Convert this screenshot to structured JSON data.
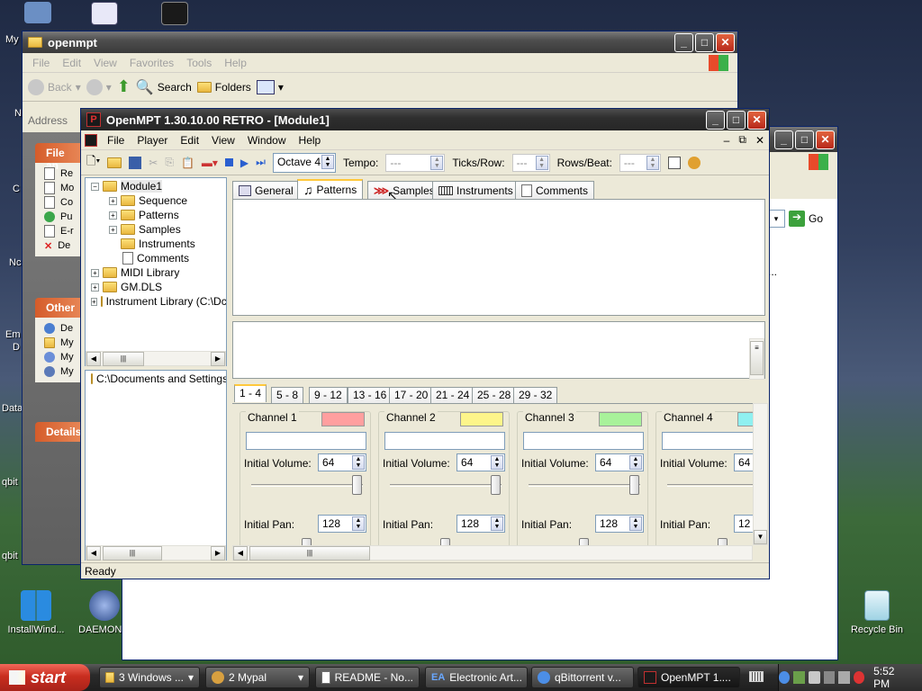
{
  "desktop": {
    "icons": [
      {
        "label": "InstallWind...",
        "color": "#1e88e5"
      },
      {
        "label": "DAEMON T",
        "color": "#3a5fa8"
      },
      {
        "label": "Recycle Bin",
        "color": "#d7eef7"
      }
    ],
    "partial_labels": [
      "My",
      "N",
      "C",
      "Nc",
      "Em",
      "D",
      "Data",
      "qbit",
      "qbit"
    ]
  },
  "explorer_window": {
    "title": "openmpt",
    "menu": [
      "File",
      "Edit",
      "View",
      "Favorites",
      "Tools",
      "Help"
    ],
    "toolbar": {
      "back": "Back",
      "search": "Search",
      "folders": "Folders"
    },
    "address_label": "Address",
    "go_label": "Go",
    "ellipsis": "...",
    "taskpane": {
      "file_head": "File an",
      "file_items": [
        "Re",
        "Mo",
        "Co",
        "Pu",
        "E-r",
        "De"
      ],
      "other_head": "Other",
      "other_items": [
        "De",
        "My",
        "My",
        "My"
      ],
      "details_head": "Details"
    }
  },
  "openmpt": {
    "title": "OpenMPT 1.30.10.00 RETRO - [Module1]",
    "menu": [
      "File",
      "Player",
      "Edit",
      "View",
      "Window",
      "Help"
    ],
    "toolbar": {
      "octave": "Octave 4",
      "tempo_label": "Tempo:",
      "tempo_value": "---",
      "ticks_label": "Ticks/Row:",
      "ticks_value": "---",
      "rows_label": "Rows/Beat:",
      "rows_value": "---"
    },
    "tree": {
      "root": "Module1",
      "children": [
        "Sequence",
        "Patterns",
        "Samples",
        "Instruments",
        "Comments"
      ],
      "others": [
        "MIDI Library",
        "GM.DLS",
        "Instrument Library (C:\\Dc"
      ]
    },
    "path": "C:\\Documents and Settings",
    "tabs": [
      "General",
      "Patterns",
      "Samples",
      "Instruments",
      "Comments"
    ],
    "selected_tab": "Patterns",
    "channel_tabs": [
      "1 - 4",
      "5 - 8",
      "9 - 12",
      "13 - 16",
      "17 - 20",
      "21 - 24",
      "25 - 28",
      "29 - 32"
    ],
    "channels": [
      {
        "name": "Channel 1",
        "color": "#ff9f9f",
        "volume_label": "Initial Volume:",
        "volume": "64",
        "pan_label": "Initial Pan:",
        "pan": "128"
      },
      {
        "name": "Channel 2",
        "color": "#fdf58a",
        "volume_label": "Initial Volume:",
        "volume": "64",
        "pan_label": "Initial Pan:",
        "pan": "128"
      },
      {
        "name": "Channel 3",
        "color": "#a8f29a",
        "volume_label": "Initial Volume:",
        "volume": "64",
        "pan_label": "Initial Pan:",
        "pan": "128"
      },
      {
        "name": "Channel 4",
        "color": "#8ff0f0",
        "volume_label": "Initial Volume:",
        "volume": "64",
        "pan_label": "Initial Pan:",
        "pan": "12"
      }
    ],
    "status": "Ready"
  },
  "taskbar": {
    "start": "start",
    "tasks": [
      "3 Windows ...",
      "2 Mypal",
      "README - No...",
      "Electronic Art...",
      "qBittorrent v...",
      "OpenMPT 1...."
    ],
    "clock": "5:52 PM"
  }
}
